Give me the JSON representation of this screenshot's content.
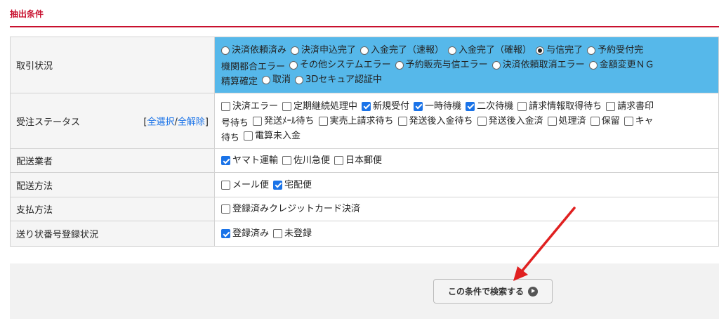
{
  "section": {
    "title": "抽出条件"
  },
  "rows": {
    "trade_status": {
      "label": "取引状況",
      "lines": [
        [
          {
            "text": "決済依頼済み",
            "checked": false
          },
          {
            "text": "決済申込完了",
            "checked": false
          },
          {
            "text": "入金完了（速報）",
            "checked": false
          },
          {
            "text": "入金完了（確報）",
            "checked": false
          },
          {
            "text": "与信完了",
            "checked": true
          },
          {
            "text": "予約受付完",
            "checked": false
          }
        ],
        [
          {
            "text": "機関都合エラー",
            "checked": null
          },
          {
            "text": "その他システムエラー",
            "checked": false
          },
          {
            "text": "予約販売与信エラー",
            "checked": false
          },
          {
            "text": "決済依頼取消エラー",
            "checked": false
          },
          {
            "text": "金額変更ＮＧ",
            "checked": false
          }
        ],
        [
          {
            "text": "精算確定",
            "checked": null
          },
          {
            "text": "取消",
            "checked": false
          },
          {
            "text": "3Dセキュア認証中",
            "checked": false
          }
        ]
      ]
    },
    "order_status": {
      "label": "受注ステータス",
      "select_all": "全選択",
      "separator": "/",
      "deselect_all": "全解除",
      "bracket_open": "[",
      "bracket_close": "]",
      "lines": [
        [
          {
            "text": "決済エラー",
            "checked": false
          },
          {
            "text": "定期継続処理中",
            "checked": false
          },
          {
            "text": "新規受付",
            "checked": true
          },
          {
            "text": "一時待機",
            "checked": true
          },
          {
            "text": "二次待機",
            "checked": true
          },
          {
            "text": "請求情報取得待ち",
            "checked": false
          },
          {
            "text": "請求書印",
            "checked": false
          }
        ],
        [
          {
            "text": "号待ち",
            "checked": null
          },
          {
            "text": "発送ﾒｰﾙ待ち",
            "checked": false
          },
          {
            "text": "実売上請求待ち",
            "checked": false
          },
          {
            "text": "発送後入金待ち",
            "checked": false
          },
          {
            "text": "発送後入金済",
            "checked": false
          },
          {
            "text": "処理済",
            "checked": false
          },
          {
            "text": "保留",
            "checked": false
          },
          {
            "text": "キャ",
            "checked": false
          }
        ],
        [
          {
            "text": "待ち",
            "checked": null
          },
          {
            "text": "電算未入金",
            "checked": false
          }
        ]
      ]
    },
    "carrier": {
      "label": "配送業者",
      "options": [
        {
          "text": "ヤマト運輸",
          "checked": true
        },
        {
          "text": "佐川急便",
          "checked": false
        },
        {
          "text": "日本郵便",
          "checked": false
        }
      ]
    },
    "delivery_method": {
      "label": "配送方法",
      "options": [
        {
          "text": "メール便",
          "checked": false
        },
        {
          "text": "宅配便",
          "checked": true
        }
      ]
    },
    "payment_method": {
      "label": "支払方法",
      "options": [
        {
          "text": "登録済みクレジットカード決済",
          "checked": false
        }
      ]
    },
    "tracking_status": {
      "label": "送り状番号登録状況",
      "options": [
        {
          "text": "登録済み",
          "checked": true
        },
        {
          "text": "未登録",
          "checked": false
        }
      ]
    }
  },
  "search": {
    "button_label": "この条件で検索する",
    "icon": "circle-play-icon"
  },
  "annotation": {
    "color": "#e02020",
    "icon": "red-arrow"
  },
  "colors": {
    "accent": "#c8102e",
    "highlight": "#56b8ea",
    "link": "#1a73e8"
  }
}
